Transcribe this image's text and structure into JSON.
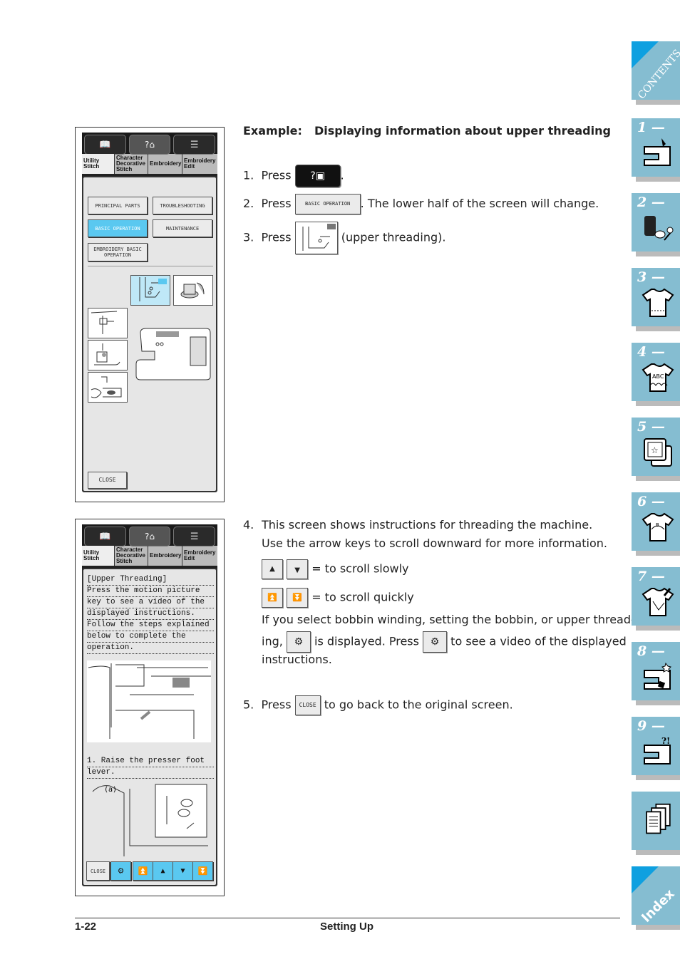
{
  "screen1": {
    "tabs": [
      "Utility Stitch",
      "Character Decorative Stitch",
      "Embroidery",
      "Embroidery Edit"
    ],
    "buttons": {
      "principal_parts": "PRINCIPAL PARTS",
      "troubleshooting": "TROUBLESHOOTING",
      "basic_operation": "BASIC OPERATION",
      "maintenance": "MAINTENANCE",
      "embroidery_basic_operation": "EMBROIDERY BASIC OPERATION",
      "close": "CLOSE"
    },
    "selected_button": "BASIC OPERATION"
  },
  "screen2": {
    "tabs": [
      "Utility Stitch",
      "Character Decorative Stitch",
      "Embroidery",
      "Embroidery Edit"
    ],
    "instruction_lines": [
      "[Upper Threading]",
      "Press the motion picture",
      "key to see a video of the",
      "displayed instructions.",
      "Follow the steps explained",
      "below to complete the",
      "operation."
    ],
    "step_lines": [
      "1. Raise the presser foot",
      "lever."
    ],
    "callout": "(a)",
    "close": "CLOSE"
  },
  "content": {
    "example_label": "Example:",
    "example_title": "Displaying information about upper threading",
    "steps": [
      {
        "num": "1.",
        "pre": "Press",
        "post": "."
      },
      {
        "num": "2.",
        "pre": "Press",
        "button": "BASIC OPERATION",
        "post": ". The lower half of the screen will change."
      },
      {
        "num": "3.",
        "pre": "Press",
        "post": "(upper threading)."
      },
      {
        "num": "4.",
        "line1": "This screen shows instructions for threading the machine.",
        "line2": "Use the arrow keys to scroll downward for more information."
      },
      {
        "num": "5.",
        "pre": "Press",
        "button": "CLOSE",
        "post": "to go back to the original screen."
      }
    ],
    "scroll_slow": "= to scroll slowly",
    "scroll_quick": "= to scroll quickly",
    "video_line1": "If you select bobbin winding, setting the bobbin, or upper thread-",
    "video_line2a": "ing,",
    "video_line2b": "is displayed. Press",
    "video_line2c": "to see a video of the displayed",
    "video_line3": "instructions."
  },
  "sidebar": {
    "contents": "CONTENTS",
    "chapters": [
      "1 —",
      "2 —",
      "3 —",
      "4 —",
      "5 —",
      "6 —",
      "7 —",
      "8 —",
      "9 —"
    ],
    "index": "Index",
    "colors": {
      "tab": "#85bdd1",
      "corner": "#0ea0e0"
    }
  },
  "footer": {
    "page_number": "1-22",
    "section": "Setting Up"
  }
}
